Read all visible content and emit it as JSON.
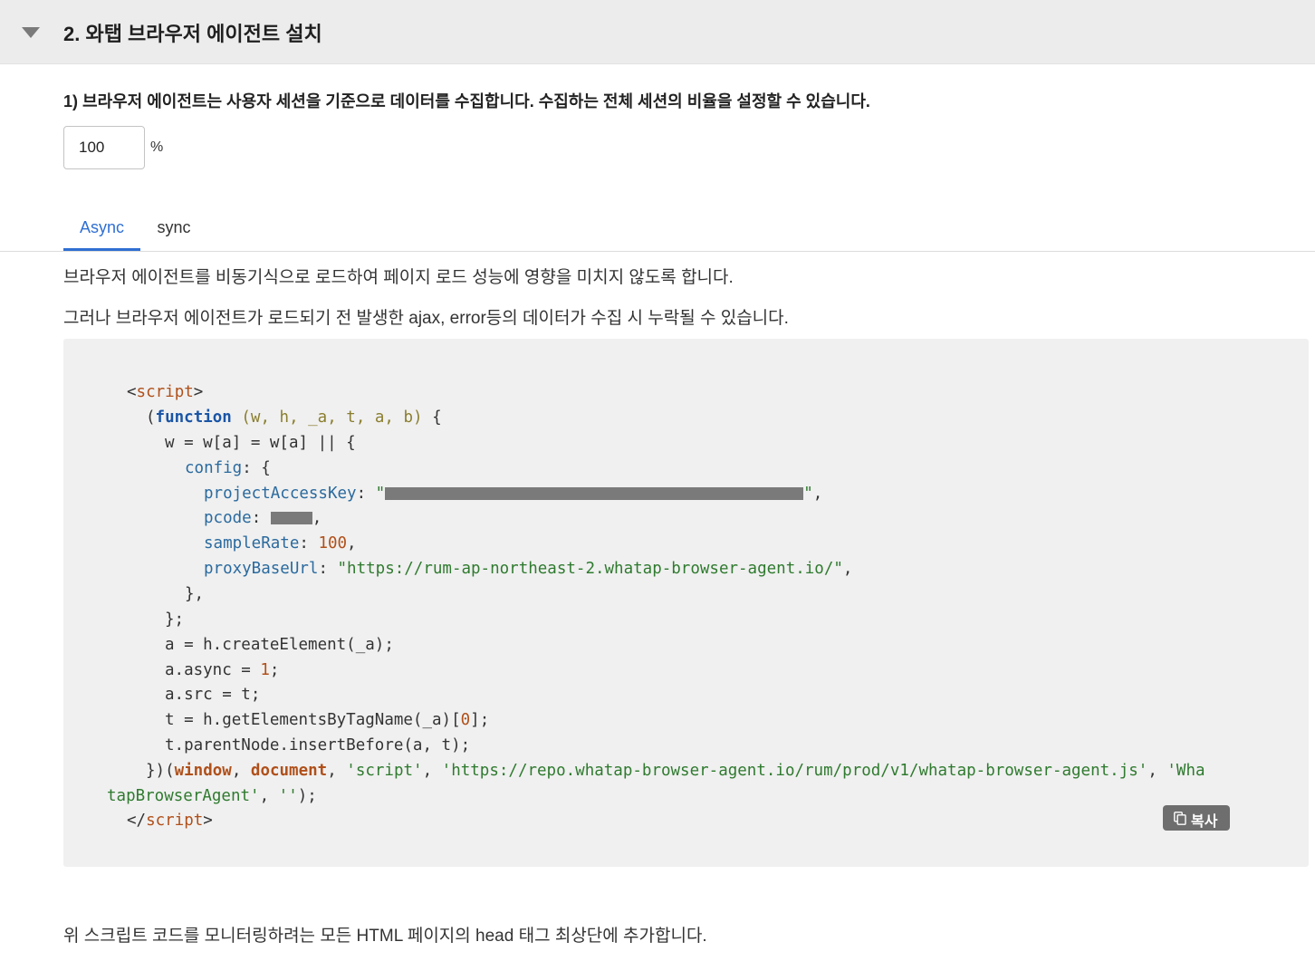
{
  "section": {
    "title": "2. 와탭 브라우저 에이전트 설치"
  },
  "sample_rate": {
    "question": "1) 브라우저 에이전트는 사용자 세션을 기준으로 데이터를 수집합니다. 수집하는 전체 세션의 비율을 설정할 수 있습니다.",
    "value": "100",
    "unit": "%"
  },
  "tabs": [
    {
      "label": "Async",
      "active": true
    },
    {
      "label": "sync",
      "active": false
    }
  ],
  "description": {
    "line1": "브라우저 에이전트를 비동기식으로 로드하여 페이지 로드 성능에 영향을 미치지 않도록 합니다.",
    "line2": "그러나 브라우저 에이전트가 로드되기 전 발생한 ajax, error등의 데이터가 수집 시 누락될 수 있습니다."
  },
  "code": {
    "open_tag": "script",
    "close_tag": "script",
    "function_keyword": "function",
    "params": "(w, h, _a, t, a, b)",
    "assign_line": "w = w[a] = w[a] || {",
    "config_key": "config",
    "project_access_key_label": "projectAccessKey",
    "pcode_label": "pcode",
    "sample_rate_label": "sampleRate",
    "sample_rate_value": "100",
    "proxy_base_url_label": "proxyBaseUrl",
    "proxy_base_url_value": "\"https://rum-ap-northeast-2.whatap-browser-agent.io/\"",
    "close_config": "},",
    "close_obj": "};",
    "line_create": "a = h.createElement(_a);",
    "line_async_prefix": "a.async = ",
    "line_async_value": "1",
    "line_src": "a.src = t;",
    "line_get_prefix": "t = h.getElementsByTagName(_a)[",
    "line_get_index": "0",
    "line_insert": "t.parentNode.insertBefore(a, t);",
    "iife_window": "window",
    "iife_document": "document",
    "iife_script_arg": "'script'",
    "iife_url": "'https://repo.whatap-browser-agent.io/rum/prod/v1/whatap-browser-agent.js'",
    "iife_name_part1": "'Wha",
    "iife_name_part2": "tapBrowserAgent'",
    "iife_empty": "''"
  },
  "copy_button": {
    "label": "복사",
    "icon": "copy-icon"
  },
  "footer": {
    "note": "위 스크립트 코드를 모니터링하려는 모든 HTML 페이지의 head 태그 최상단에 추가합니다."
  },
  "colors": {
    "active_tab": "#2f6fd3",
    "header_bg": "#ececec",
    "code_bg": "#f0f0f0",
    "copy_button_bg": "#6e6e6e"
  }
}
